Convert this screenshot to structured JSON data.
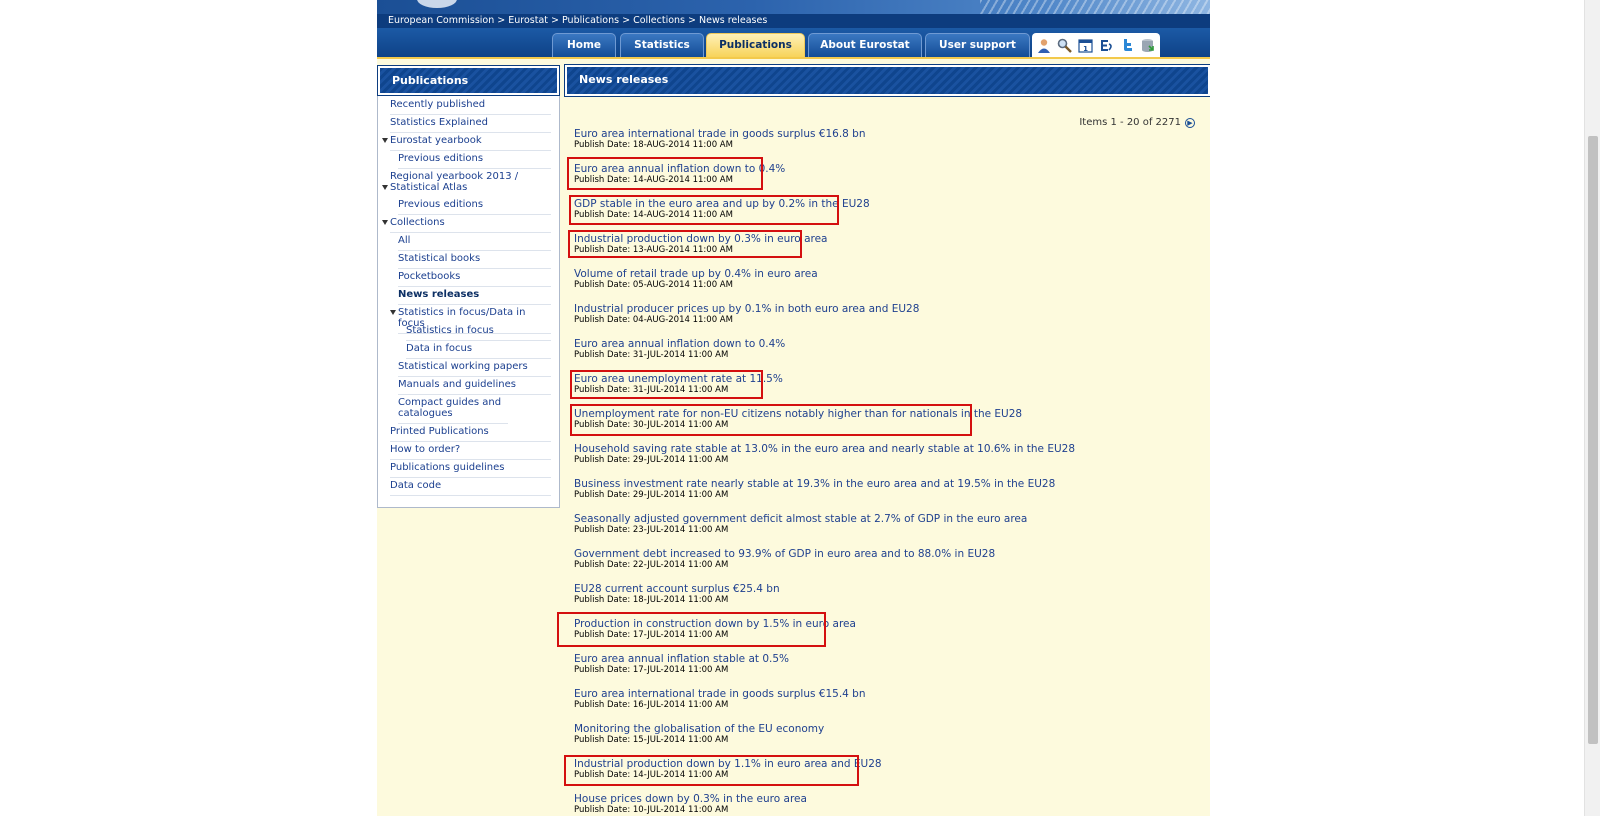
{
  "breadcrumb": "European Commission > Eurostat > Publications > Collections > News releases",
  "nav": {
    "tabs": [
      {
        "label": "Home"
      },
      {
        "label": "Statistics"
      },
      {
        "label": "Publications"
      },
      {
        "label": "About Eurostat"
      },
      {
        "label": "User support"
      }
    ],
    "active_tab": "Publications"
  },
  "sidebar": {
    "title": "Publications",
    "items": [
      {
        "label": "Recently published"
      },
      {
        "label": "Statistics Explained"
      },
      {
        "label": "Eurostat yearbook"
      },
      {
        "label": "Previous editions"
      },
      {
        "label": "Regional yearbook 2013 / Statistical Atlas"
      },
      {
        "label": "Previous editions"
      },
      {
        "label": "Collections"
      },
      {
        "label": "All"
      },
      {
        "label": "Statistical books"
      },
      {
        "label": "Pocketbooks"
      },
      {
        "label": "News releases"
      },
      {
        "label": "Statistics in focus/Data in focus"
      },
      {
        "label": "Statistics in focus"
      },
      {
        "label": "Data in focus"
      },
      {
        "label": "Statistical working papers"
      },
      {
        "label": "Manuals and guidelines"
      },
      {
        "label": "Compact guides and catalogues"
      },
      {
        "label": "Printed Publications"
      },
      {
        "label": "How to order?"
      },
      {
        "label": "Publications guidelines"
      },
      {
        "label": "Data code"
      }
    ]
  },
  "main": {
    "title": "News releases",
    "pager": "Items 1 - 20 of 2271",
    "items": [
      {
        "title": "Euro area international trade in goods surplus €16.8 bn",
        "date": "Publish Date: 18-AUG-2014 11:00 AM"
      },
      {
        "title": "Euro area annual inflation down to 0.4%",
        "date": "Publish Date: 14-AUG-2014 11:00 AM"
      },
      {
        "title": "GDP stable in the euro area and up by 0.2% in the EU28",
        "date": "Publish Date: 14-AUG-2014 11:00 AM"
      },
      {
        "title": "Industrial production down by 0.3% in euro area",
        "date": "Publish Date: 13-AUG-2014 11:00 AM"
      },
      {
        "title": "Volume of retail trade up by 0.4% in euro area",
        "date": "Publish Date: 05-AUG-2014 11:00 AM"
      },
      {
        "title": "Industrial producer prices up by 0.1% in both euro area and EU28",
        "date": "Publish Date: 04-AUG-2014 11:00 AM"
      },
      {
        "title": "Euro area annual inflation down to 0.4%",
        "date": "Publish Date: 31-JUL-2014 11:00 AM"
      },
      {
        "title": "Euro area unemployment rate at 11.5%",
        "date": "Publish Date: 31-JUL-2014 11:00 AM"
      },
      {
        "title": "Unemployment rate for non-EU citizens notably higher than for nationals in the EU28",
        "date": "Publish Date: 30-JUL-2014 11:00 AM"
      },
      {
        "title": "Household saving rate stable at 13.0% in the euro area and nearly stable at 10.6% in the EU28",
        "date": "Publish Date: 29-JUL-2014 11:00 AM"
      },
      {
        "title": "Business investment rate nearly stable at 19.3% in the euro area and at 19.5% in the EU28",
        "date": "Publish Date: 29-JUL-2014 11:00 AM"
      },
      {
        "title": "Seasonally adjusted government deficit almost stable at 2.7% of GDP in the euro area",
        "date": "Publish Date: 23-JUL-2014 11:00 AM"
      },
      {
        "title": "Government debt increased to 93.9% of GDP in euro area and to 88.0% in EU28",
        "date": "Publish Date: 22-JUL-2014 11:00 AM"
      },
      {
        "title": "EU28 current account surplus €25.4 bn",
        "date": "Publish Date: 18-JUL-2014 11:00 AM"
      },
      {
        "title": "Production in construction down by 1.5% in euro area",
        "date": "Publish Date: 17-JUL-2014 11:00 AM"
      },
      {
        "title": "Euro area annual inflation stable at 0.5%",
        "date": "Publish Date: 17-JUL-2014 11:00 AM"
      },
      {
        "title": "Euro area international trade in goods surplus €15.4 bn",
        "date": "Publish Date: 16-JUL-2014 11:00 AM"
      },
      {
        "title": "Monitoring the globalisation of the EU economy",
        "date": "Publish Date: 15-JUL-2014 11:00 AM"
      },
      {
        "title": "Industrial production down by 1.1% in euro area and EU28",
        "date": "Publish Date: 14-JUL-2014 11:00 AM"
      },
      {
        "title": "House prices down by 0.3% in the euro area",
        "date": "Publish Date: 10-JUL-2014 11:00 AM"
      }
    ]
  },
  "icons": [
    "user-icon",
    "search-icon",
    "calendar-icon",
    "rss-icon",
    "twitter-icon",
    "database-icon"
  ],
  "colors": {
    "header_blue": "#0f458e",
    "page_bg": "#fdfadd",
    "link": "#20418f",
    "highlight": "#d40f0f",
    "active_tab": "#f7d35a"
  }
}
